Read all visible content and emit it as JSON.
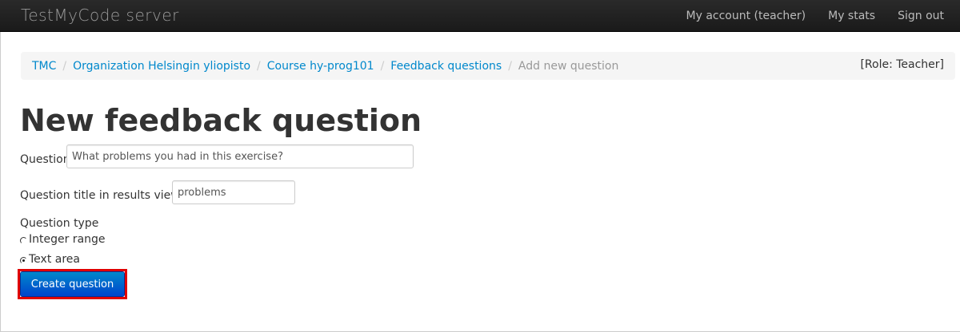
{
  "app": {
    "brand": "TestMyCode server"
  },
  "nav": {
    "items": [
      {
        "label": "My account (teacher)"
      },
      {
        "label": "My stats"
      },
      {
        "label": "Sign out"
      }
    ]
  },
  "breadcrumb": {
    "items": [
      {
        "label": "TMC"
      },
      {
        "label": "Organization Helsingin yliopisto"
      },
      {
        "label": "Course hy-prog101"
      },
      {
        "label": "Feedback questions"
      }
    ],
    "separator": "/",
    "active": "Add new question",
    "role": "[Role: Teacher]"
  },
  "page": {
    "title": "New feedback question"
  },
  "form": {
    "question_label": "Question",
    "question_value": "What problems you had in this exercise?",
    "title_label": "Question title in results views",
    "title_value": "problems",
    "type_label": "Question type",
    "type_options": [
      {
        "label": "Integer range",
        "checked": false
      },
      {
        "label": "Text area",
        "checked": true
      }
    ],
    "submit_label": "Create question"
  },
  "colors": {
    "link": "#0088cc",
    "primary_button": "#0055cc",
    "highlight": "#e00000"
  }
}
